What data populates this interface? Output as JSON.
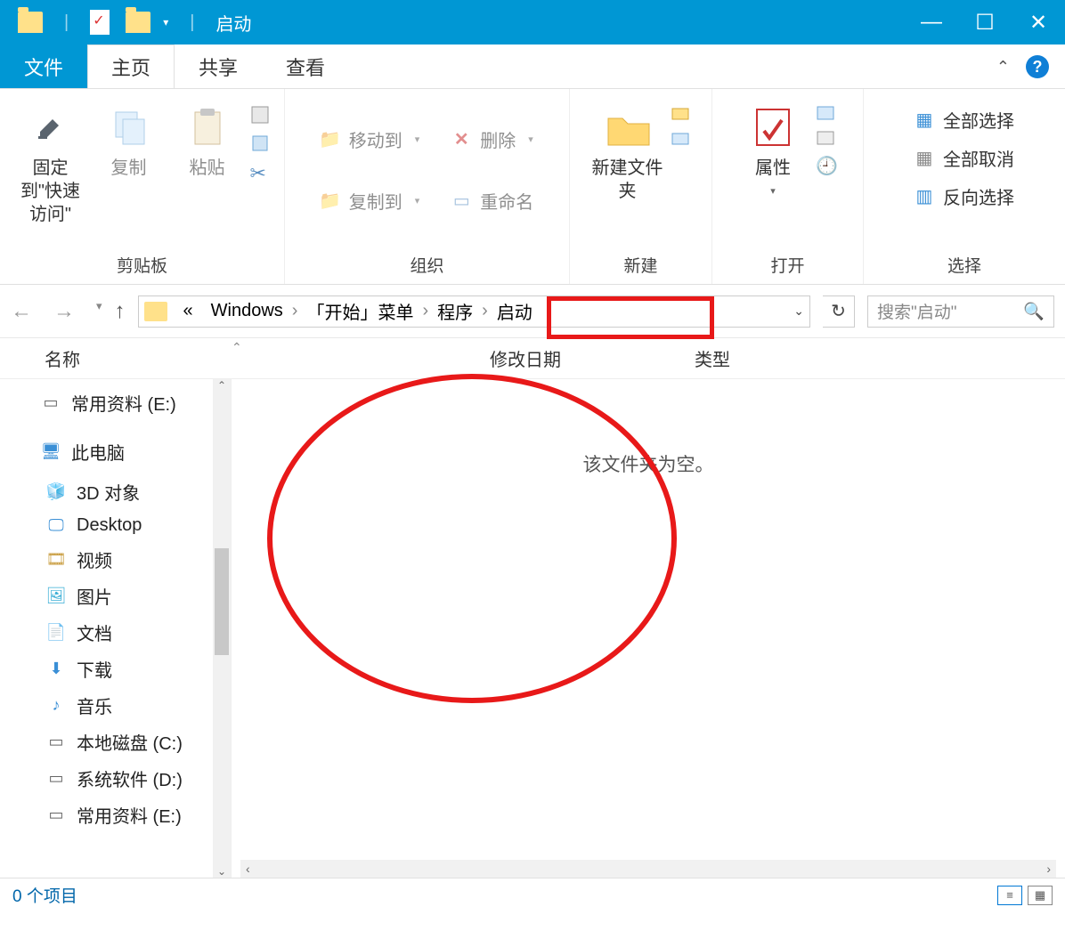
{
  "title": "启动",
  "tabs": {
    "file": "文件",
    "home": "主页",
    "share": "共享",
    "view": "查看"
  },
  "ribbon": {
    "clipboard": {
      "label": "剪贴板",
      "pin": "固定到\"快速访问\"",
      "copy": "复制",
      "paste": "粘贴"
    },
    "organize": {
      "label": "组织",
      "moveTo": "移动到",
      "copyTo": "复制到",
      "delete": "删除",
      "rename": "重命名"
    },
    "new": {
      "label": "新建",
      "newFolder": "新建文件夹"
    },
    "open": {
      "label": "打开",
      "properties": "属性"
    },
    "select": {
      "label": "选择",
      "all": "全部选择",
      "none": "全部取消",
      "invert": "反向选择"
    }
  },
  "breadcrumb": {
    "pre": "«",
    "items": [
      "Windows",
      "「开始」菜单",
      "程序",
      "启动"
    ]
  },
  "search": {
    "placeholder": "搜索\"启动\""
  },
  "columns": {
    "name": "名称",
    "date": "修改日期",
    "type": "类型"
  },
  "sidebar": {
    "items": [
      {
        "label": "常用资料 (E:)",
        "icon": "drive"
      },
      {
        "label": "此电脑",
        "icon": "pc",
        "pc": true
      },
      {
        "label": "3D 对象",
        "icon": "3d"
      },
      {
        "label": "Desktop",
        "icon": "desktop"
      },
      {
        "label": "视频",
        "icon": "video"
      },
      {
        "label": "图片",
        "icon": "pic"
      },
      {
        "label": "文档",
        "icon": "doc"
      },
      {
        "label": "下载",
        "icon": "down"
      },
      {
        "label": "音乐",
        "icon": "music"
      },
      {
        "label": "本地磁盘 (C:)",
        "icon": "drive"
      },
      {
        "label": "系统软件 (D:)",
        "icon": "drive"
      },
      {
        "label": "常用资料 (E:)",
        "icon": "drive"
      }
    ]
  },
  "empty": "该文件夹为空。",
  "status": "0 个项目"
}
